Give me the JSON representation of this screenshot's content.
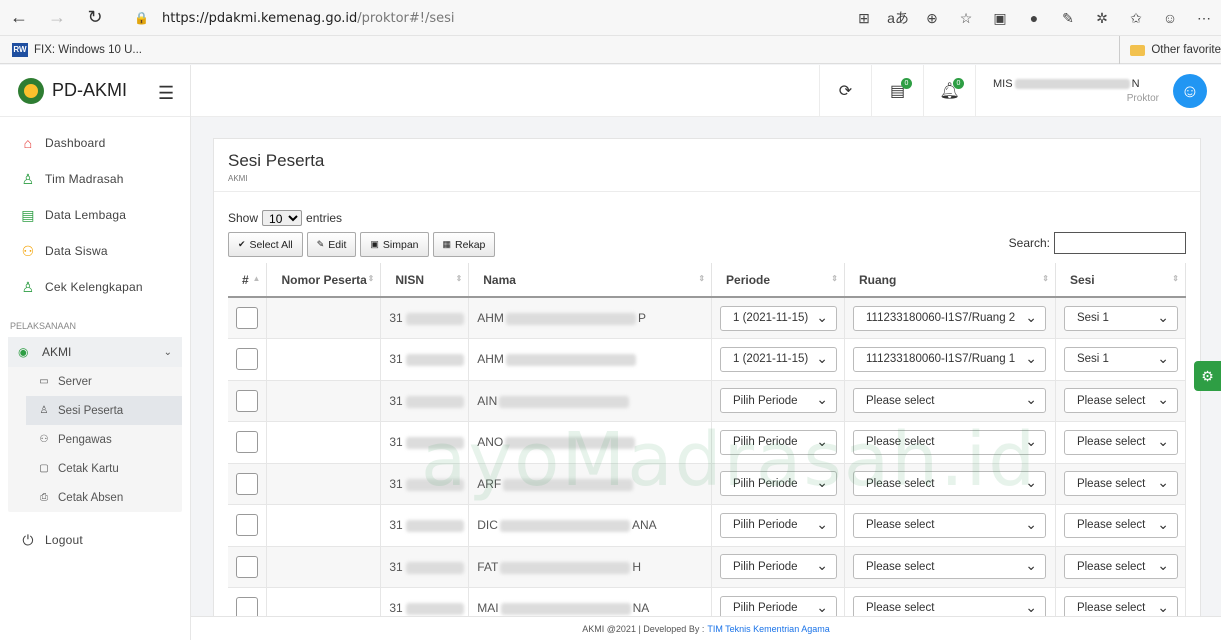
{
  "browser": {
    "url_host": "https://pdakmi.kemenag.go.id",
    "url_path": "/proktor#!/sesi",
    "favorite_label": "FIX: Windows 10 U...",
    "favorite_badge": "RW",
    "other_favorites": "Other favorite"
  },
  "sidebar": {
    "brand": "PD-AKMI",
    "items": [
      {
        "label": "Dashboard",
        "icon": "home-icon"
      },
      {
        "label": "Tim Madrasah",
        "icon": "user-icon"
      },
      {
        "label": "Data Lembaga",
        "icon": "building-icon"
      },
      {
        "label": "Data Siswa",
        "icon": "users-icon"
      },
      {
        "label": "Cek Kelengkapan",
        "icon": "user-check-icon"
      }
    ],
    "section": "PELAKSANAAN",
    "group": {
      "label": "AKMI",
      "subitems": [
        {
          "label": "Server",
          "icon": "monitor-icon"
        },
        {
          "label": "Sesi Peserta",
          "icon": "user-icon"
        },
        {
          "label": "Pengawas",
          "icon": "users-icon"
        },
        {
          "label": "Cetak Kartu",
          "icon": "card-icon"
        },
        {
          "label": "Cetak Absen",
          "icon": "print-icon"
        }
      ]
    },
    "logout": "Logout"
  },
  "topbar": {
    "chat_badge": "0",
    "bell_badge": "0",
    "user_prefix": "MIS",
    "user_suffix": "N",
    "user_role": "Proktor"
  },
  "page": {
    "title": "Sesi Peserta",
    "subtitle": "AKMI",
    "show_label": "Show",
    "entries_value": "10",
    "entries_label": "entries",
    "search_label": "Search:",
    "buttons": {
      "select_all": "Select All",
      "edit": "Edit",
      "simpan": "Simpan",
      "rekap": "Rekap"
    }
  },
  "table": {
    "headers": [
      "#",
      "Nomor Peserta",
      "NISN",
      "Nama",
      "Periode",
      "Ruang",
      "Sesi"
    ],
    "rows": [
      {
        "nisn": "31",
        "nama_start": "AHM",
        "nama_end": "P",
        "periode": "1 (2021-11-15)",
        "ruang": "111233180060-I1S7/Ruang 2",
        "sesi": "Sesi 1"
      },
      {
        "nisn": "31",
        "nama_start": "AHM",
        "nama_end": "",
        "periode": "1 (2021-11-15)",
        "ruang": "111233180060-I1S7/Ruang 1",
        "sesi": "Sesi 1"
      },
      {
        "nisn": "31",
        "nama_start": "AIN",
        "nama_end": "",
        "periode": "Pilih Periode",
        "ruang": "Please select",
        "sesi": "Please select"
      },
      {
        "nisn": "31",
        "nama_start": "ANO",
        "nama_end": "",
        "periode": "Pilih Periode",
        "ruang": "Please select",
        "sesi": "Please select"
      },
      {
        "nisn": "31",
        "nama_start": "ARF",
        "nama_end": "",
        "periode": "Pilih Periode",
        "ruang": "Please select",
        "sesi": "Please select"
      },
      {
        "nisn": "31",
        "nama_start": "DIC",
        "nama_end": "ANA",
        "periode": "Pilih Periode",
        "ruang": "Please select",
        "sesi": "Please select"
      },
      {
        "nisn": "31",
        "nama_start": "FAT",
        "nama_end": "H",
        "periode": "Pilih Periode",
        "ruang": "Please select",
        "sesi": "Please select"
      },
      {
        "nisn": "31",
        "nama_start": "MAI",
        "nama_end": "NA",
        "periode": "Pilih Periode",
        "ruang": "Please select",
        "sesi": "Please select"
      }
    ]
  },
  "footer": {
    "text": "AKMI @2021 | Developed By :",
    "link": "TIM Teknis Kementrian Agama"
  },
  "watermark": "ayoMadrasah.id",
  "colors": {
    "accent": "#2e9e44",
    "avatar": "#2196f3"
  }
}
